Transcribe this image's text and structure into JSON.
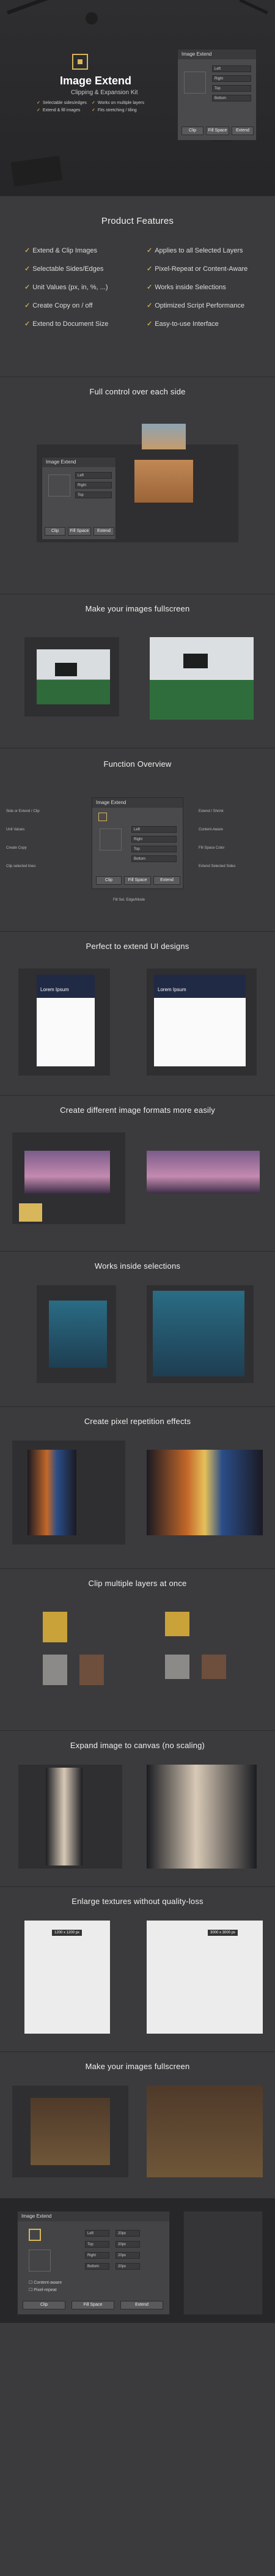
{
  "hero": {
    "title": "Image Extend",
    "subtitle": "Clipping & Expansion Kit",
    "features_left": [
      "Selectable sides/edges",
      "Extend & fill images"
    ],
    "features_right": [
      "Works on multiple layers",
      "Fits stretching / tiling"
    ],
    "panel": {
      "title": "Image Extend",
      "fields": [
        "Left",
        "Right",
        "Top",
        "Bottom"
      ],
      "buttons": [
        "Clip",
        "Fill Space",
        "Extend"
      ]
    }
  },
  "product_features": {
    "heading": "Product Features",
    "left": [
      "Extend & Clip Images",
      "Selectable Sides/Edges",
      "Unit Values (px, in, %, ...)",
      "Create Copy on / off",
      "Extend to Document Size"
    ],
    "right": [
      "Applies to all Selected Layers",
      "Pixel-Repeat or Content-Aware",
      "Works inside Selections",
      "Optimized Script Performance",
      "Easy-to-use Interface"
    ]
  },
  "sections": [
    {
      "title": "Full control over each side"
    },
    {
      "title": "Make your images fullscreen"
    },
    {
      "title": "Function Overview"
    },
    {
      "title": "Perfect to extend UI designs"
    },
    {
      "title": "Create different image formats more easily"
    },
    {
      "title": "Works inside selections"
    },
    {
      "title": "Create pixel repetition effects"
    },
    {
      "title": "Clip multiple layers at once"
    },
    {
      "title": "Expand image to canvas (no scaling)"
    },
    {
      "title": "Enlarge textures without quality-loss"
    },
    {
      "title": "Make your images fullscreen"
    }
  ],
  "function_overview": {
    "panel_title": "Image Extend",
    "left_notes": [
      "Side or Extend / Clip",
      "Unit Values",
      "Create Copy",
      "Clip selected lines"
    ],
    "right_notes": [
      "Extend / Shrink",
      "Content-Aware",
      "Fill Space Color",
      "Extend Selected Sides"
    ],
    "bottom_note": "Fill Sel. Edge/Mode"
  },
  "ui_design": {
    "card_title": "Lorem Ipsum"
  },
  "textures": {
    "badge_left": "1200 x 1200 px",
    "badge_right": "3000 x 3000 px"
  },
  "bottom_panel": {
    "title": "Image Extend",
    "fields": [
      "Left",
      "Top",
      "Right",
      "Bottom"
    ],
    "values": [
      "20px",
      "20px",
      "20px",
      "20px"
    ],
    "checkbox_labels": [
      "Content-aware",
      "Pixel-repeat"
    ],
    "buttons": [
      "Clip",
      "Fill Space",
      "Extend"
    ]
  },
  "colors": {
    "accent": "#d8b65a",
    "bg": "#3b3b3d",
    "dark": "#2a2a2c"
  }
}
